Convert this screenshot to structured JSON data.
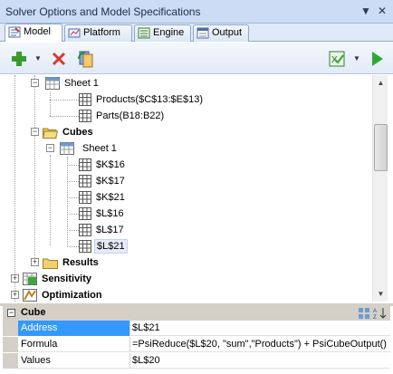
{
  "window": {
    "title": "Solver Options and Model Specifications",
    "pin_icon": "dropdown-arrow-icon",
    "close_icon": "close-icon"
  },
  "tabs": [
    {
      "label": "Model",
      "icon": "model-icon",
      "active": true
    },
    {
      "label": "Platform",
      "icon": "platform-icon",
      "active": false
    },
    {
      "label": "Engine",
      "icon": "engine-icon",
      "active": false
    },
    {
      "label": "Output",
      "icon": "output-icon",
      "active": false
    }
  ],
  "toolbar": {
    "add_icon": "plus-icon",
    "dropdown_icon": "dropdown-arrow-icon",
    "delete_icon": "delete-x-icon",
    "refresh_icon": "refresh-icon",
    "analyze_icon": "analyze-check-icon",
    "run_icon": "run-arrow-icon",
    "colors": {
      "add": "#3c9a2c",
      "delete": "#d63a2a",
      "run": "#2fa83a"
    }
  },
  "tree": {
    "sheet1_a": "Sheet 1",
    "products": "Products($C$13:$E$13)",
    "parts": "Parts(B18:B22)",
    "cubes": "Cubes",
    "sheet1_b": "Sheet 1",
    "cells": [
      "$K$16",
      "$K$17",
      "$K$21",
      "$L$16",
      "$L$17",
      "$L$21"
    ],
    "results": "Results",
    "sensitivity": "Sensitivity",
    "optimization": "Optimization"
  },
  "properties": {
    "category": "Cube",
    "rows": [
      {
        "name": "Address",
        "value": "$L$21",
        "selected": true
      },
      {
        "name": "Formula",
        "value": "=PsiReduce($L$20, \"sum\",\"Products\") + PsiCubeOutput()",
        "selected": false
      },
      {
        "name": "Values",
        "value": "$L$20",
        "selected": false
      }
    ],
    "sort_categorized_icon": "categorized-icon",
    "sort_alpha_icon": "sort-az-icon"
  }
}
